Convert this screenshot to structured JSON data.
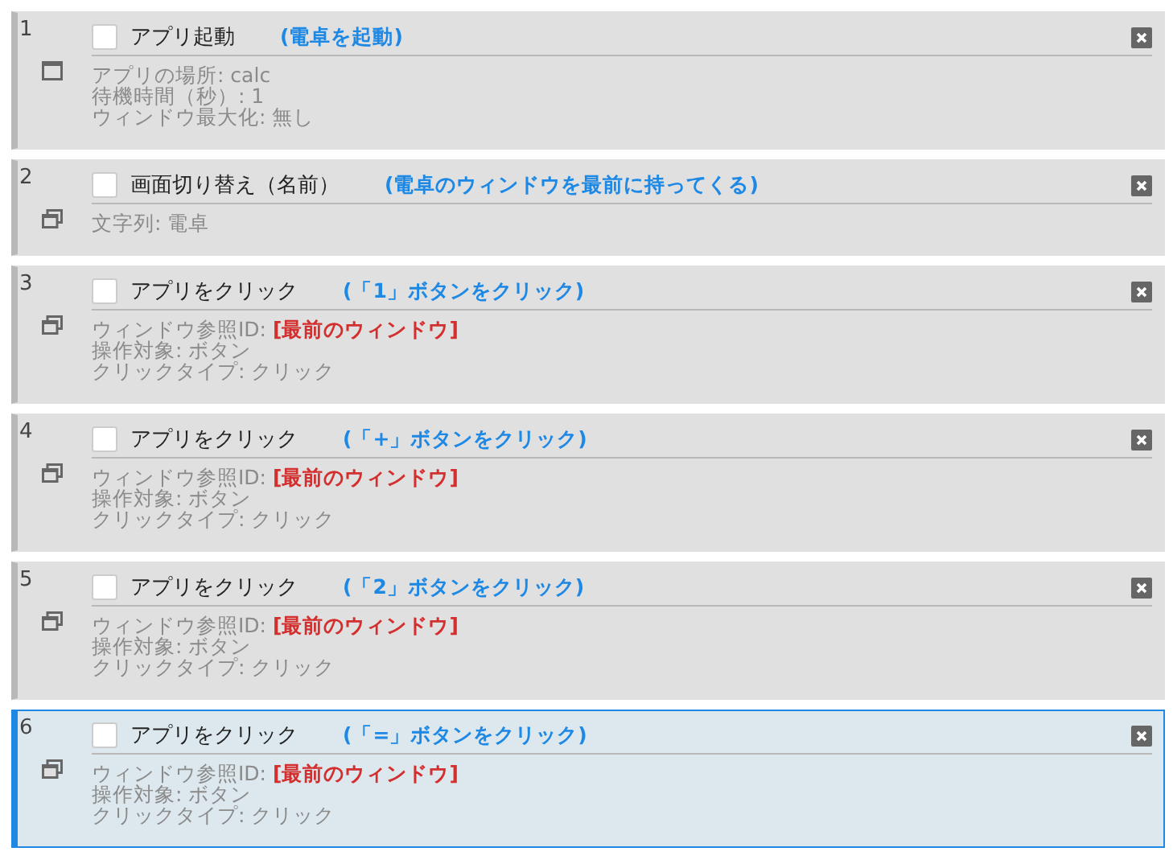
{
  "steps": [
    {
      "number": "1",
      "checked": false,
      "title": "アプリ起動",
      "comment": "(電卓を起動)",
      "kind": "launch",
      "selected": false,
      "details": [
        {
          "label": "アプリの場所: calc"
        },
        {
          "label": "待機時間（秒）: 1"
        },
        {
          "label": "ウィンドウ最大化: 無し"
        }
      ]
    },
    {
      "number": "2",
      "checked": false,
      "title": "画面切り替え（名前）",
      "comment": "(電卓のウィンドウを最前に持ってくる)",
      "kind": "window",
      "selected": false,
      "details": [
        {
          "label": "文字列: 電卓"
        }
      ]
    },
    {
      "number": "3",
      "checked": false,
      "title": "アプリをクリック",
      "comment": "(「1」ボタンをクリック)",
      "kind": "window",
      "selected": false,
      "details": [
        {
          "label": "ウィンドウ参照ID:",
          "value": "[最前のウィンドウ]"
        },
        {
          "label": "操作対象: ボタン"
        },
        {
          "label": "クリックタイプ: クリック"
        }
      ]
    },
    {
      "number": "4",
      "checked": false,
      "title": "アプリをクリック",
      "comment": "(「+」ボタンをクリック)",
      "kind": "window",
      "selected": false,
      "details": [
        {
          "label": "ウィンドウ参照ID:",
          "value": "[最前のウィンドウ]"
        },
        {
          "label": "操作対象: ボタン"
        },
        {
          "label": "クリックタイプ: クリック"
        }
      ]
    },
    {
      "number": "5",
      "checked": false,
      "title": "アプリをクリック",
      "comment": "(「2」ボタンをクリック)",
      "kind": "window",
      "selected": false,
      "details": [
        {
          "label": "ウィンドウ参照ID:",
          "value": "[最前のウィンドウ]"
        },
        {
          "label": "操作対象: ボタン"
        },
        {
          "label": "クリックタイプ: クリック"
        }
      ]
    },
    {
      "number": "6",
      "checked": false,
      "title": "アプリをクリック",
      "comment": "(「=」ボタンをクリック)",
      "kind": "window",
      "selected": true,
      "details": [
        {
          "label": "ウィンドウ参照ID:",
          "value": "[最前のウィンドウ]"
        },
        {
          "label": "操作対象: ボタン"
        },
        {
          "label": "クリックタイプ: クリック"
        }
      ]
    }
  ]
}
